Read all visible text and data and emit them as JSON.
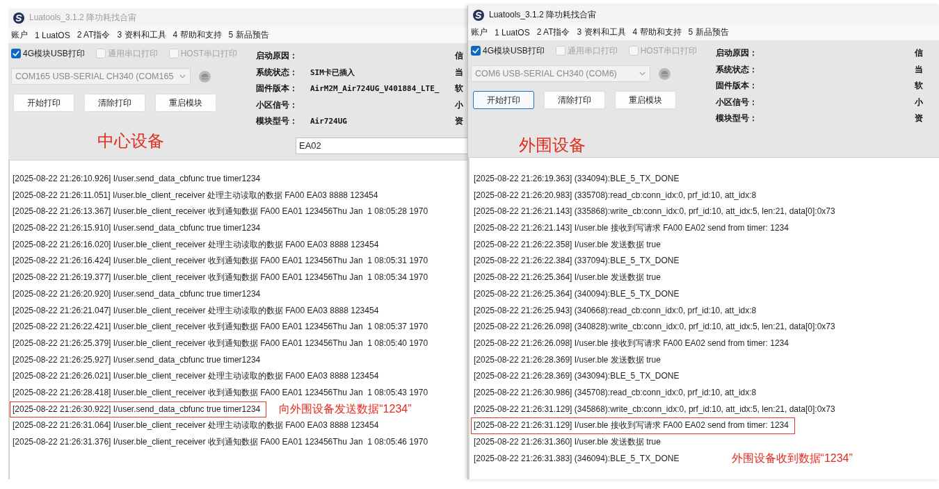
{
  "windows": [
    {
      "title": "Luatools_3.1.2 降功耗找合宙",
      "active": false,
      "menu": [
        "账户",
        "1 LuatOS",
        "2 AT指令",
        "3 资料和工具",
        "4 帮助和支持",
        "5 新品预告"
      ],
      "print_options": [
        {
          "label": "4G模块USB打印",
          "checked": true,
          "disabled": false
        },
        {
          "label": "通用串口打印",
          "checked": false,
          "disabled": true
        },
        {
          "label": "HOST串口打印",
          "checked": false,
          "disabled": true
        }
      ],
      "port": {
        "value": "COM165 USB-SERIAL CH340 (COM165",
        "disabled": true
      },
      "buttons": [
        {
          "label": "开始打印",
          "focused": false
        },
        {
          "label": "清除打印",
          "focused": false
        },
        {
          "label": "重启模块",
          "focused": false
        }
      ],
      "info": [
        {
          "label": "启动原因："
        },
        {
          "label": "系统状态：",
          "value": "SIM卡已插入"
        },
        {
          "label": "固件版本：",
          "value": "AirM2M_Air724UG_V401884_LTE_"
        },
        {
          "label": "小区信号："
        },
        {
          "label": "模块型号：",
          "value": "Air724UG"
        }
      ],
      "info_column_2": [
        "信",
        "当",
        "软",
        "小",
        "资"
      ],
      "annotation": "中心设备",
      "filter": {
        "value": "EA02"
      },
      "log": [
        {
          "text": "[2025-08-22 21:26:10.926] I/user.send_data_cbfunc true timer1234",
          "highlighted": false
        },
        {
          "text": "[2025-08-22 21:26:11.051] I/user.ble_client_receiver 处理主动读取的数据 FA00 EA03 8888 123454",
          "highlighted": false
        },
        {
          "text": "[2025-08-22 21:26:13.367] I/user.ble_client_receiver 收到通知数据 FA00 EA01 123456Thu Jan  1 08:05:28 1970",
          "highlighted": false
        },
        {
          "text": "[2025-08-22 21:26:15.910] I/user.send_data_cbfunc true timer1234",
          "highlighted": false
        },
        {
          "text": "[2025-08-22 21:26:16.020] I/user.ble_client_receiver 处理主动读取的数据 FA00 EA03 8888 123454",
          "highlighted": false
        },
        {
          "text": "[2025-08-22 21:26:16.424] I/user.ble_client_receiver 收到通知数据 FA00 EA01 123456Thu Jan  1 08:05:31 1970",
          "highlighted": false
        },
        {
          "text": "[2025-08-22 21:26:19.377] I/user.ble_client_receiver 收到通知数据 FA00 EA01 123456Thu Jan  1 08:05:34 1970",
          "highlighted": false
        },
        {
          "text": "[2025-08-22 21:26:20.920] I/user.send_data_cbfunc true timer1234",
          "highlighted": false
        },
        {
          "text": "[2025-08-22 21:26:21.047] I/user.ble_client_receiver 处理主动读取的数据 FA00 EA03 8888 123454",
          "highlighted": false
        },
        {
          "text": "[2025-08-22 21:26:22.421] I/user.ble_client_receiver 收到通知数据 FA00 EA01 123456Thu Jan  1 08:05:37 1970",
          "highlighted": false
        },
        {
          "text": "[2025-08-22 21:26:25.379] I/user.ble_client_receiver 收到通知数据 FA00 EA01 123456Thu Jan  1 08:05:40 1970",
          "highlighted": false
        },
        {
          "text": "[2025-08-22 21:26:25.927] I/user.send_data_cbfunc true timer1234",
          "highlighted": false
        },
        {
          "text": "[2025-08-22 21:26:26.021] I/user.ble_client_receiver 处理主动读取的数据 FA00 EA03 8888 123454",
          "highlighted": false
        },
        {
          "text": "[2025-08-22 21:26:28.418] I/user.ble_client_receiver 收到通知数据 FA00 EA01 123456Thu Jan  1 08:05:43 1970",
          "highlighted": false
        },
        {
          "text": "[2025-08-22 21:26:30.922] I/user.send_data_cbfunc true timer1234",
          "highlighted": true,
          "note": "向外围设备发送数据“1234”"
        },
        {
          "text": "[2025-08-22 21:26:31.064] I/user.ble_client_receiver 处理主动读取的数据 FA00 EA03 8888 123454",
          "highlighted": false
        },
        {
          "text": "[2025-08-22 21:26:31.376] I/user.ble_client_receiver 收到通知数据 FA00 EA01 123456Thu Jan  1 08:05:46 1970",
          "highlighted": false
        }
      ]
    },
    {
      "title": "Luatools_3.1.2 降功耗找合宙",
      "active": true,
      "menu": [
        "账户",
        "1 LuatOS",
        "2 AT指令",
        "3 资料和工具",
        "4 帮助和支持",
        "5 新品预告"
      ],
      "print_options": [
        {
          "label": "4G模块USB打印",
          "checked": true,
          "disabled": false
        },
        {
          "label": "通用串口打印",
          "checked": false,
          "disabled": true
        },
        {
          "label": "HOST串口打印",
          "checked": false,
          "disabled": true
        }
      ],
      "port": {
        "value": "COM6 USB-SERIAL CH340 (COM6)",
        "disabled": true
      },
      "buttons": [
        {
          "label": "开始打印",
          "focused": true
        },
        {
          "label": "清除打印",
          "focused": false
        },
        {
          "label": "重启模块",
          "focused": false
        }
      ],
      "info": [
        {
          "label": "启动原因："
        },
        {
          "label": "系统状态："
        },
        {
          "label": "固件版本："
        },
        {
          "label": "小区信号："
        },
        {
          "label": "模块型号："
        }
      ],
      "info_column_2": [
        "信",
        "当",
        "软",
        "小",
        "资"
      ],
      "annotation": "外围设备",
      "log": [
        {
          "text": "[2025-08-22 21:26:19.363] (334094):BLE_5_TX_DONE",
          "highlighted": false
        },
        {
          "text": "[2025-08-22 21:26:20.983] (335708):read_cb:conn_idx:0, prf_id:10, att_idx:8",
          "highlighted": false
        },
        {
          "text": "[2025-08-22 21:26:21.143] (335868):write_cb:conn_idx:0, prf_id:10, att_idx:5, len:21, data[0]:0x73",
          "highlighted": false
        },
        {
          "text": "[2025-08-22 21:26:21.143] I/user.ble 接收到写请求 FA00 EA02 send from timer: 1234",
          "highlighted": false
        },
        {
          "text": "[2025-08-22 21:26:22.358] I/user.ble 发送数据 true",
          "highlighted": false
        },
        {
          "text": "[2025-08-22 21:26:22.384] (337094):BLE_5_TX_DONE",
          "highlighted": false
        },
        {
          "text": "[2025-08-22 21:26:25.364] I/user.ble 发送数据 true",
          "highlighted": false
        },
        {
          "text": "[2025-08-22 21:26:25.364] (340094):BLE_5_TX_DONE",
          "highlighted": false
        },
        {
          "text": "[2025-08-22 21:26:25.943] (340668):read_cb:conn_idx:0, prf_id:10, att_idx:8",
          "highlighted": false
        },
        {
          "text": "[2025-08-22 21:26:26.098] (340828):write_cb:conn_idx:0, prf_id:10, att_idx:5, len:21, data[0]:0x73",
          "highlighted": false
        },
        {
          "text": "[2025-08-22 21:26:26.098] I/user.ble 接收到写请求 FA00 EA02 send from timer: 1234",
          "highlighted": false
        },
        {
          "text": "[2025-08-22 21:26:28.369] I/user.ble 发送数据 true",
          "highlighted": false
        },
        {
          "text": "[2025-08-22 21:26:28.369] (343094):BLE_5_TX_DONE",
          "highlighted": false
        },
        {
          "text": "[2025-08-22 21:26:30.986] (345708):read_cb:conn_idx:0, prf_id:10, att_idx:8",
          "highlighted": false
        },
        {
          "text": "[2025-08-22 21:26:31.129] (345868):write_cb:conn_idx:0, prf_id:10, att_idx:5, len:21, data[0]:0x73",
          "highlighted": false
        },
        {
          "text": "[2025-08-22 21:26:31.129] I/user.ble 接收到写请求 FA00 EA02 send from timer: 1234",
          "highlighted": true
        },
        {
          "text": "[2025-08-22 21:26:31.360] I/user.ble 发送数据 true",
          "highlighted": false
        },
        {
          "text": "[2025-08-22 21:26:31.383] (346094):BLE_5_TX_DONE",
          "highlighted": false,
          "note": "外围设备收到数据“1234”"
        }
      ]
    }
  ]
}
